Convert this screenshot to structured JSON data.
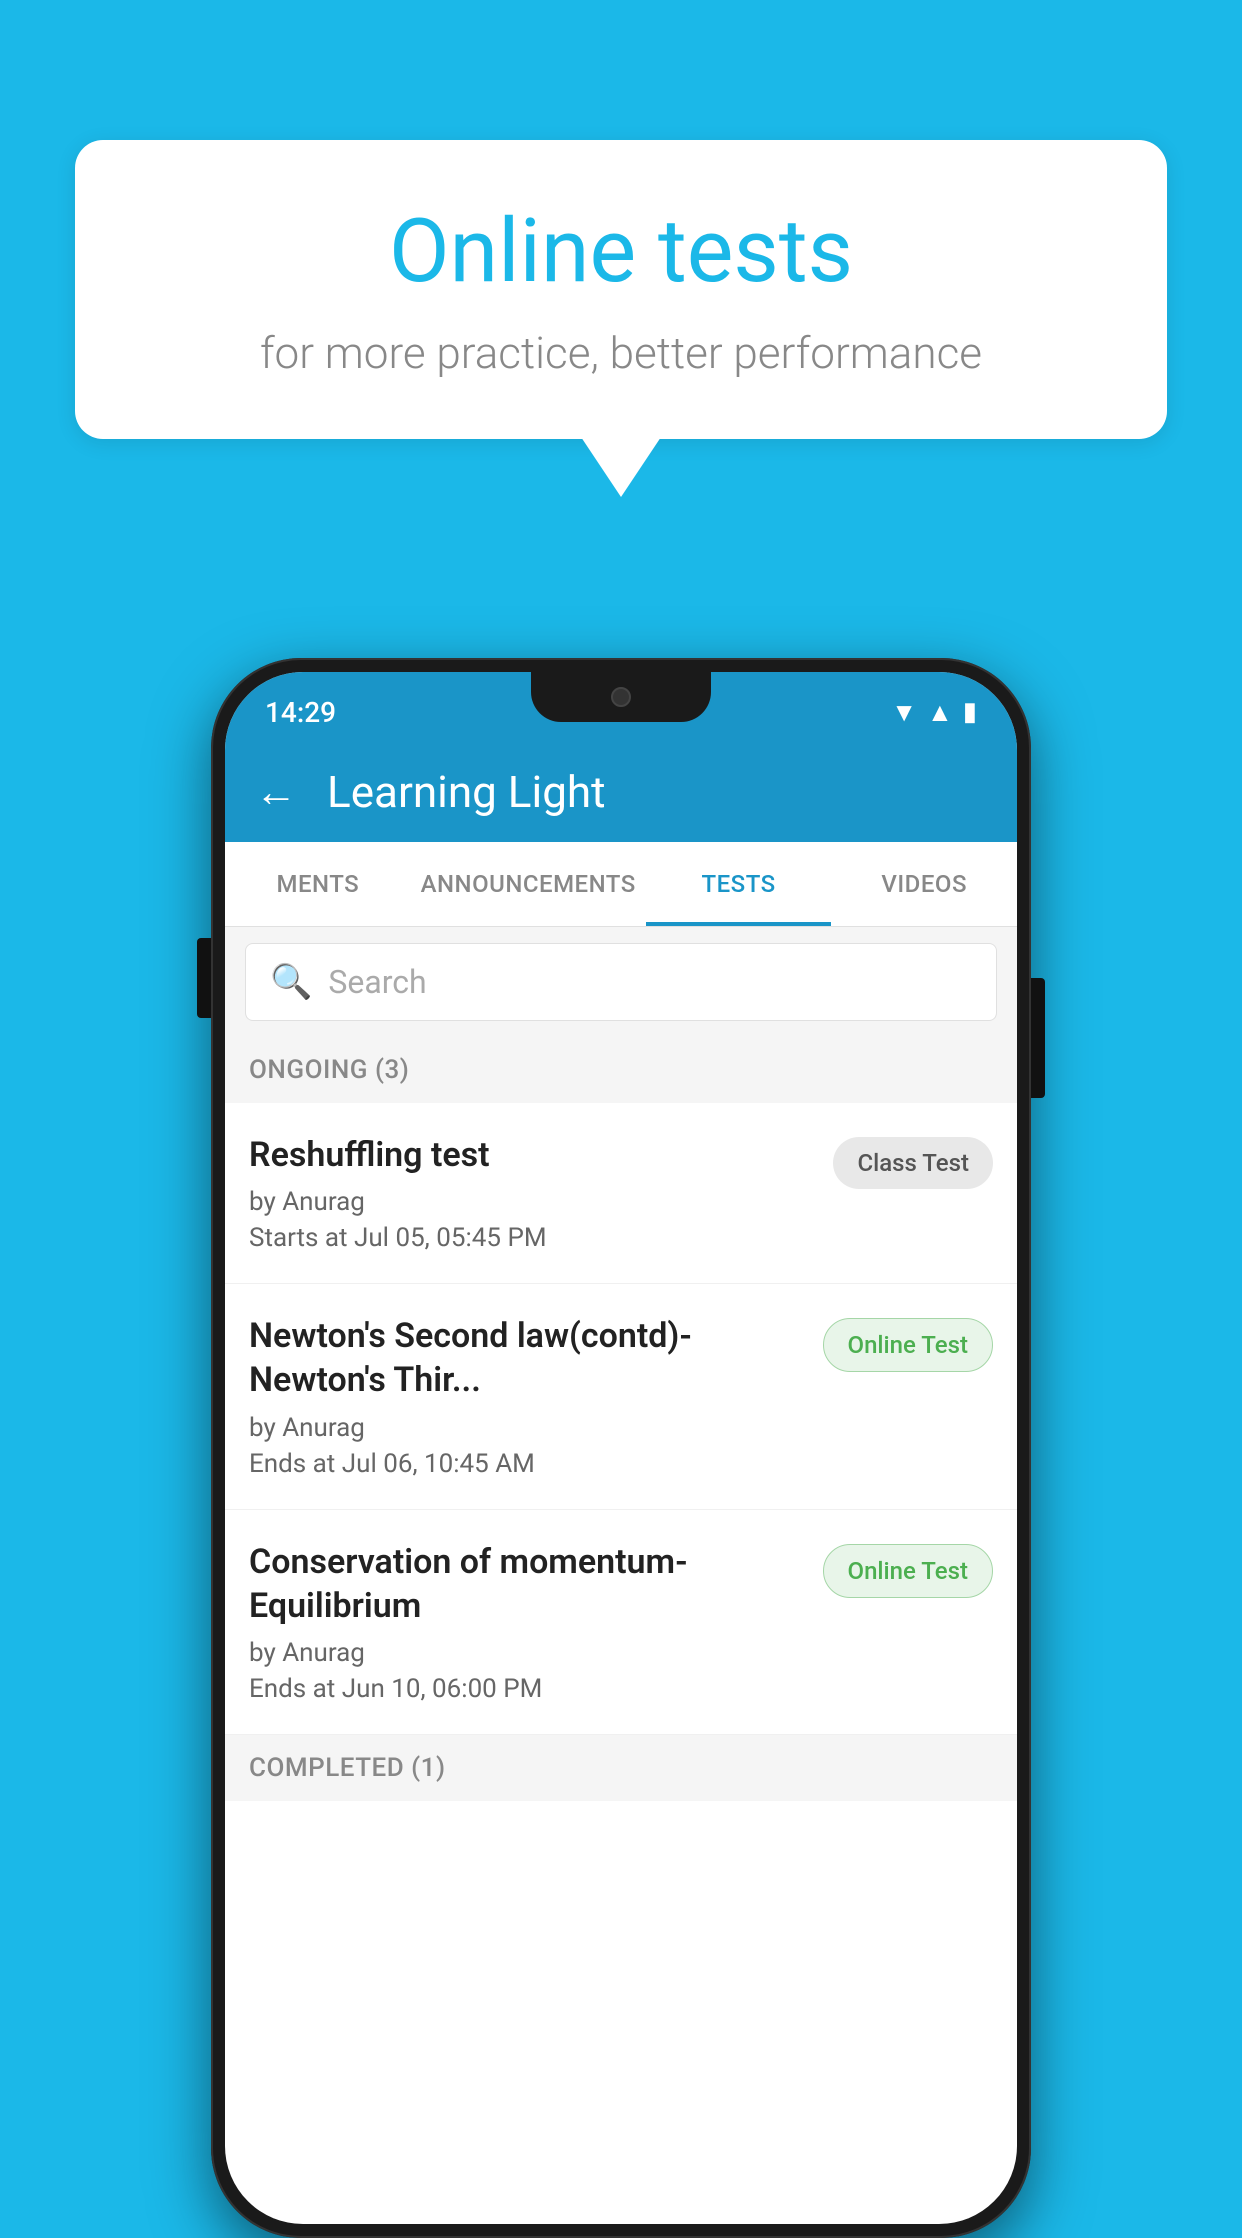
{
  "background_color": "#1BB8E8",
  "speech_bubble": {
    "title": "Online tests",
    "subtitle": "for more practice, better performance"
  },
  "phone": {
    "status_bar": {
      "time": "14:29",
      "icons": [
        "wifi",
        "signal",
        "battery"
      ]
    },
    "app_bar": {
      "back_label": "←",
      "title": "Learning Light"
    },
    "tabs": [
      {
        "label": "MENTS",
        "active": false
      },
      {
        "label": "ANNOUNCEMENTS",
        "active": false
      },
      {
        "label": "TESTS",
        "active": true
      },
      {
        "label": "VIDEOS",
        "active": false
      }
    ],
    "search": {
      "placeholder": "Search",
      "icon": "🔍"
    },
    "ongoing_section": {
      "label": "ONGOING (3)",
      "tests": [
        {
          "name": "Reshuffling test",
          "author": "by Anurag",
          "time": "Starts at  Jul 05, 05:45 PM",
          "badge": "Class Test",
          "badge_type": "class"
        },
        {
          "name": "Newton's Second law(contd)-Newton's Thir...",
          "author": "by Anurag",
          "time": "Ends at  Jul 06, 10:45 AM",
          "badge": "Online Test",
          "badge_type": "online"
        },
        {
          "name": "Conservation of momentum-Equilibrium",
          "author": "by Anurag",
          "time": "Ends at  Jun 10, 06:00 PM",
          "badge": "Online Test",
          "badge_type": "online"
        }
      ]
    },
    "completed_section": {
      "label": "COMPLETED (1)"
    }
  }
}
